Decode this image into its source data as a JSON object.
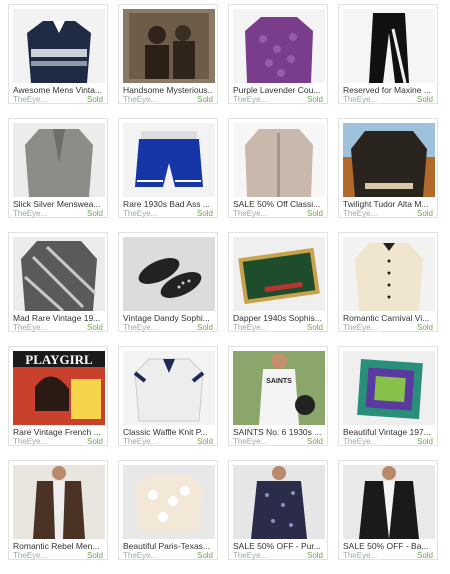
{
  "items": [
    {
      "title": "Awesome Mens Vinta...",
      "shop": "TheEye...",
      "status": "Sold",
      "image": "mens-sweater-photo"
    },
    {
      "title": "Handsome Mysterious...",
      "shop": "TheEye...",
      "status": "Sold",
      "image": "sepia-portrait-photo"
    },
    {
      "title": "Purple Lavender Cou...",
      "shop": "TheEye...",
      "status": "Sold",
      "image": "purple-cardigan-photo"
    },
    {
      "title": "Reserved for Maxine ...",
      "shop": "TheEye...",
      "status": "Sold",
      "image": "leather-pants-photo"
    },
    {
      "title": "Slick Silver Menswea...",
      "shop": "TheEye...",
      "status": "Sold",
      "image": "silver-blazer-photo"
    },
    {
      "title": "Rare 1930s Bad Ass ...",
      "shop": "TheEye...",
      "status": "Sold",
      "image": "blue-shorts-photo"
    },
    {
      "title": "SALE 50% Off Classi...",
      "shop": "TheEye...",
      "status": "Sold",
      "image": "beige-jacket-photo"
    },
    {
      "title": "Twilight Tudor Alta M...",
      "shop": "TheEye...",
      "status": "Sold",
      "image": "leather-jacket-photo"
    },
    {
      "title": "Mad Rare Vintage 19...",
      "shop": "TheEye...",
      "status": "Sold",
      "image": "metallic-shirt-photo"
    },
    {
      "title": "Vintage Dandy Sophi...",
      "shop": "TheEye...",
      "status": "Sold",
      "image": "studded-slippers-photo"
    },
    {
      "title": "Dapper 1940s Sophis...",
      "shop": "TheEye...",
      "status": "Sold",
      "image": "cigarette-case-photo"
    },
    {
      "title": "Romantic Carnival Vi...",
      "shop": "TheEye...",
      "status": "Sold",
      "image": "cream-blouse-photo"
    },
    {
      "title": "Rare Vintage French ...",
      "shop": "TheEye...",
      "status": "Sold",
      "image": "playgirl-magazine-photo",
      "cover_text": "PLAYGIRL"
    },
    {
      "title": "Classic Waffle Knit P...",
      "shop": "TheEye...",
      "status": "Sold",
      "image": "polo-shirt-photo"
    },
    {
      "title": "SAINTS No. 6 1930s ...",
      "shop": "TheEye...",
      "status": "Sold",
      "image": "saints-tank-photo",
      "shirt_text": "SAINTS"
    },
    {
      "title": "Beautiful Vintage 197...",
      "shop": "TheEye...",
      "status": "Sold",
      "image": "silk-scarf-photo"
    },
    {
      "title": "Romantic Rebel Men...",
      "shop": "TheEye...",
      "status": "Sold",
      "image": "leather-vest-photo"
    },
    {
      "title": "Beautiful Paris-Texas...",
      "shop": "TheEye...",
      "status": "Sold",
      "image": "fuzzy-sweater-photo"
    },
    {
      "title": "SALE 50% OFF - Pur...",
      "shop": "TheEye...",
      "status": "Sold",
      "image": "print-shirt-photo"
    },
    {
      "title": "SALE 50% OFF - Ba...",
      "shop": "TheEye...",
      "status": "Sold",
      "image": "biker-jacket-photo"
    }
  ],
  "colors": {
    "sold": "#6aa84f",
    "shop": "#9aa",
    "title": "#333333",
    "border": "#e2e2e2"
  }
}
